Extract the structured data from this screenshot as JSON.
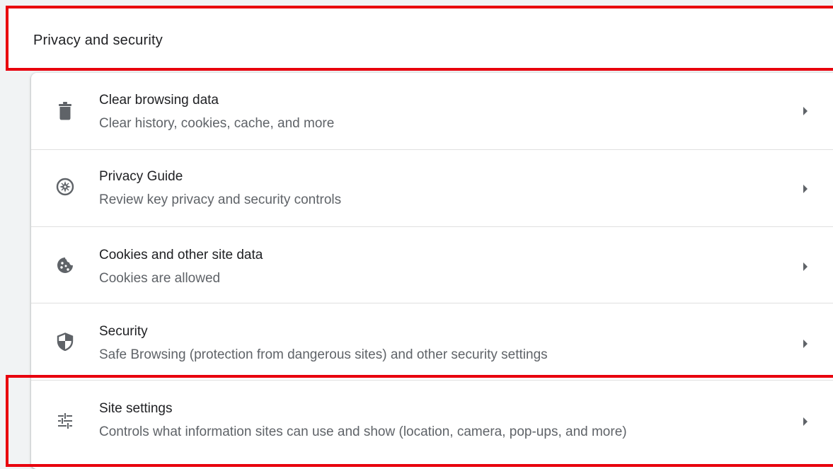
{
  "section": {
    "title": "Privacy and security"
  },
  "rows": [
    {
      "label": "Clear browsing data",
      "sublabel": "Clear history, cookies, cache, and more",
      "icon": "trash-icon"
    },
    {
      "label": "Privacy Guide",
      "sublabel": "Review key privacy and security controls",
      "icon": "compass-icon"
    },
    {
      "label": "Cookies and other site data",
      "sublabel": "Cookies are allowed",
      "icon": "cookie-icon"
    },
    {
      "label": "Security",
      "sublabel": "Safe Browsing (protection from dangerous sites) and other security settings",
      "icon": "shield-icon"
    },
    {
      "label": "Site settings",
      "sublabel": "Controls what information sites can use and show (location, camera, pop-ups, and more)",
      "icon": "tune-sliders-icon"
    }
  ],
  "colors": {
    "highlight": "#e8000d",
    "icon": "#5f6368",
    "text_primary": "#202124",
    "text_secondary": "#5f6368"
  }
}
